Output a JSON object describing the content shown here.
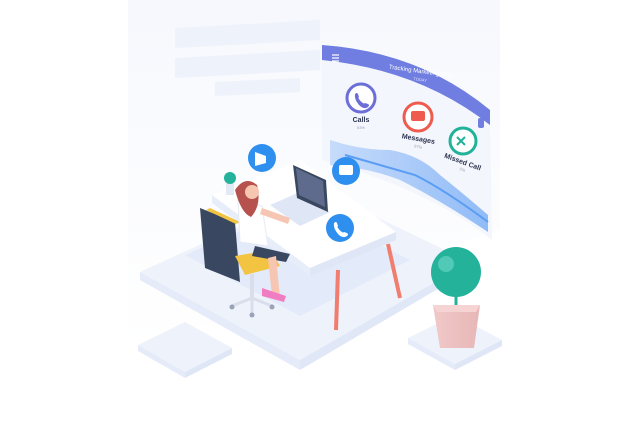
{
  "panel": {
    "title": "Tracking Marketing ROI",
    "subtitle": "TODAY",
    "stats": [
      {
        "label": "Calls",
        "value": "53%",
        "color": "#6b6fd6"
      },
      {
        "label": "Messages",
        "value": "87%",
        "color": "#ee5b4f"
      },
      {
        "label": "Missed Call",
        "value": "5%",
        "color": "#21b39a"
      }
    ]
  },
  "colors": {
    "accent_blue": "#2f8fef",
    "panel_header": "#6f7ee0",
    "desk_legs": "#f07d6e",
    "chair_seat": "#f3c342",
    "chair_back": "#3a4760",
    "plant": "#24b29b"
  },
  "icons": [
    "menu-icon",
    "phone-icon",
    "message-icon",
    "missed-call-icon",
    "bubble-megaphone-icon",
    "bubble-chat-icon",
    "bubble-phone-icon"
  ]
}
